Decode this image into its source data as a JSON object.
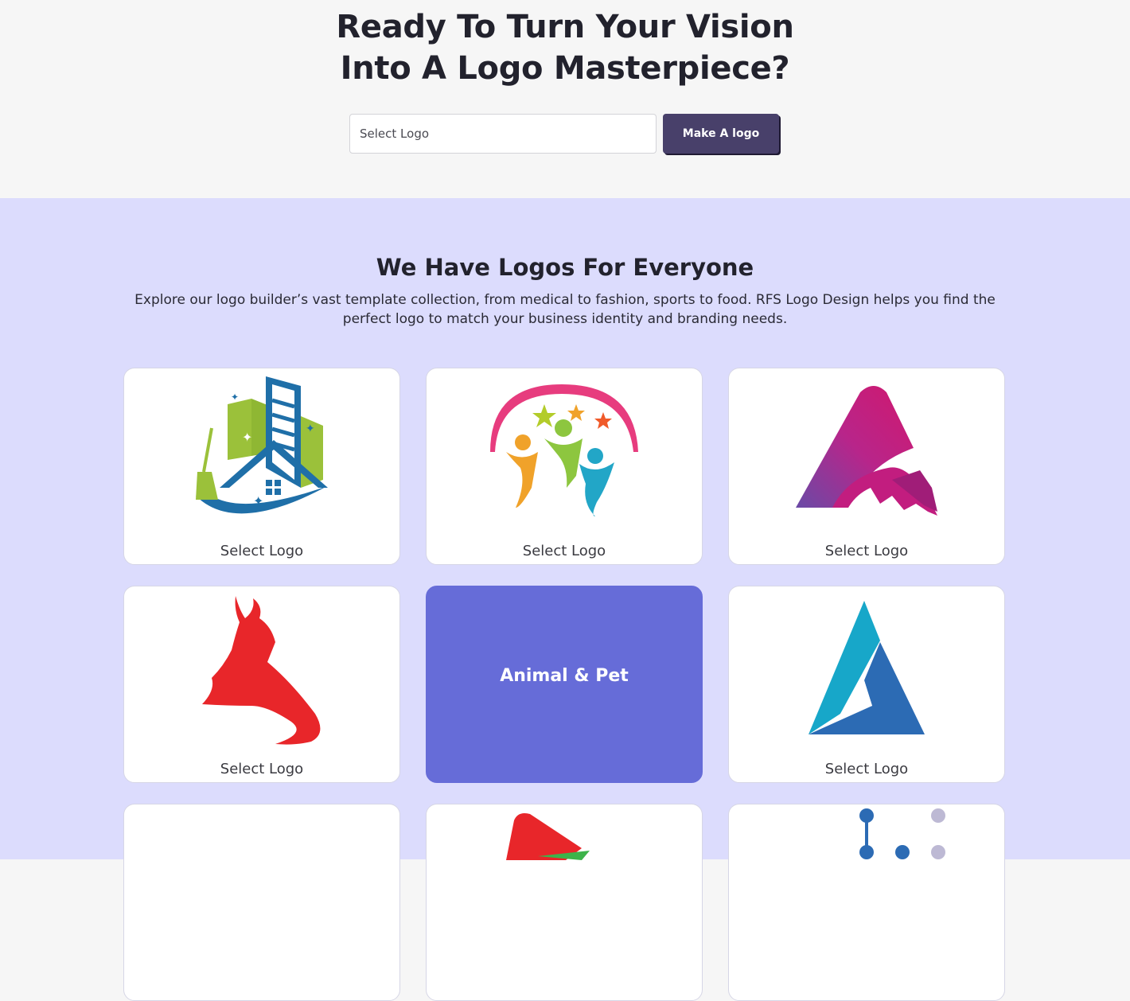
{
  "hero": {
    "title_line1": "Ready To Turn Your Vision",
    "title_line2": "Into A Logo Masterpiece?",
    "search_placeholder": "Select Logo",
    "button_label": "Make A logo",
    "button_color": "#48406a"
  },
  "catalog": {
    "heading": "We Have Logos For Everyone",
    "description": "Explore our logo builder’s vast template collection, from medical to fashion, sports to food. RFS Logo Design helps you find the perfect logo to match your business identity and branding needs.",
    "background": "#dcdcfd",
    "feature_color": "#666cd8",
    "cards": [
      {
        "label": "Select Logo",
        "icon": "cleaning-house-icon"
      },
      {
        "label": "Select Logo",
        "icon": "people-celebration-icon"
      },
      {
        "label": "Select Logo",
        "icon": "letter-a-brush-icon"
      },
      {
        "label": "Select Logo",
        "icon": "fashion-dress-icon"
      },
      {
        "label": "Animal & Pet",
        "icon": ""
      },
      {
        "label": "Select Logo",
        "icon": "triangle-a-icon"
      },
      {
        "label": "",
        "icon": ""
      },
      {
        "label": "",
        "icon": "play-arrow-icon"
      },
      {
        "label": "",
        "icon": "dots-network-icon"
      }
    ]
  }
}
